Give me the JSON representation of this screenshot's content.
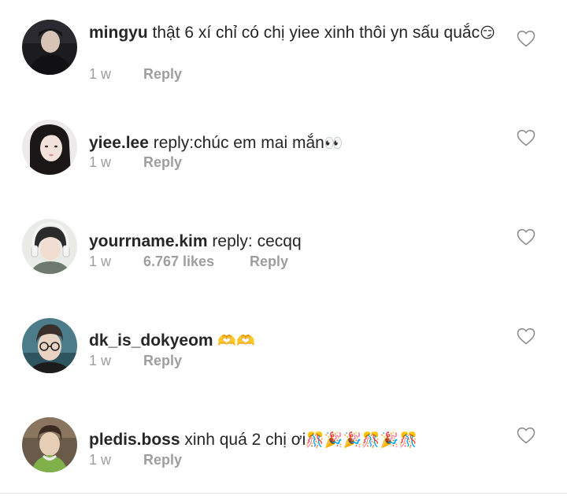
{
  "comments": [
    {
      "username": "mingyu",
      "text": "thật 6 xí chỉ có chị yiee xinh thôi yn sấu quắc",
      "emoji": "😏",
      "time": "1 w",
      "likes": "",
      "reply_label": "Reply",
      "avatar_icon": "profile-photo-icon"
    },
    {
      "username": "yiee.lee",
      "text": "reply:chúc em mai mắn",
      "emoji": "👀",
      "time": "1 w",
      "likes": "",
      "reply_label": "Reply",
      "avatar_icon": "profile-photo-icon"
    },
    {
      "username": "yourrname.kim",
      "text": "reply: cecqq",
      "emoji": "",
      "time": "1 w",
      "likes": "6.767 likes",
      "reply_label": "Reply",
      "avatar_icon": "profile-photo-icon"
    },
    {
      "username": "dk_is_dokyeom",
      "text": "",
      "emoji": "🫶🫶",
      "time": "1 w",
      "likes": "",
      "reply_label": "Reply",
      "avatar_icon": "profile-photo-icon"
    },
    {
      "username": "pledis.boss",
      "text": "xinh quá 2 chị ơi",
      "emoji": "🎊🎉🎉🎊🎉🎊",
      "time": "1 w",
      "likes": "",
      "reply_label": "Reply",
      "avatar_icon": "profile-photo-icon"
    }
  ],
  "icons": {
    "like": "heart-outline-icon"
  },
  "colors": {
    "text": "#262626",
    "meta": "#9e9e9e",
    "heart_stroke": "#8e8e8e"
  }
}
